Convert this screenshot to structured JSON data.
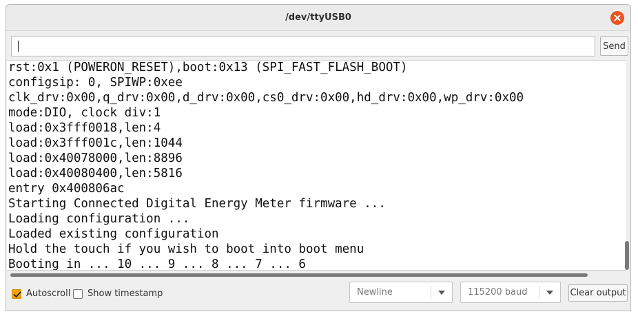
{
  "window": {
    "title": "/dev/ttyUSB0"
  },
  "input": {
    "value": "",
    "send_label": "Send"
  },
  "output": {
    "lines": [
      "rst:0x1 (POWERON_RESET),boot:0x13 (SPI_FAST_FLASH_BOOT)",
      "configsip: 0, SPIWP:0xee",
      "clk_drv:0x00,q_drv:0x00,d_drv:0x00,cs0_drv:0x00,hd_drv:0x00,wp_drv:0x00",
      "mode:DIO, clock div:1",
      "load:0x3fff0018,len:4",
      "load:0x3fff001c,len:1044",
      "load:0x40078000,len:8896",
      "load:0x40080400,len:5816",
      "entry 0x400806ac",
      "Starting Connected Digital Energy Meter firmware ...",
      "Loading configuration ...",
      "Loaded existing configuration",
      "Hold the touch if you wish to boot into boot menu",
      "Booting in ... 10 ... 9 ... 8 ... 7 ... 6"
    ]
  },
  "bottom": {
    "autoscroll_label": "Autoscroll",
    "autoscroll_checked": true,
    "timestamp_label": "Show timestamp",
    "timestamp_checked": false,
    "line_ending": "Newline",
    "baud_rate": "115200 baud",
    "clear_label": "Clear output"
  },
  "colors": {
    "accent": "#f0a30a",
    "close_button": "#e95420"
  },
  "icons": {
    "close": "close-icon",
    "checkmark": "checkmark-icon",
    "dropdown": "chevron-down-icon"
  }
}
